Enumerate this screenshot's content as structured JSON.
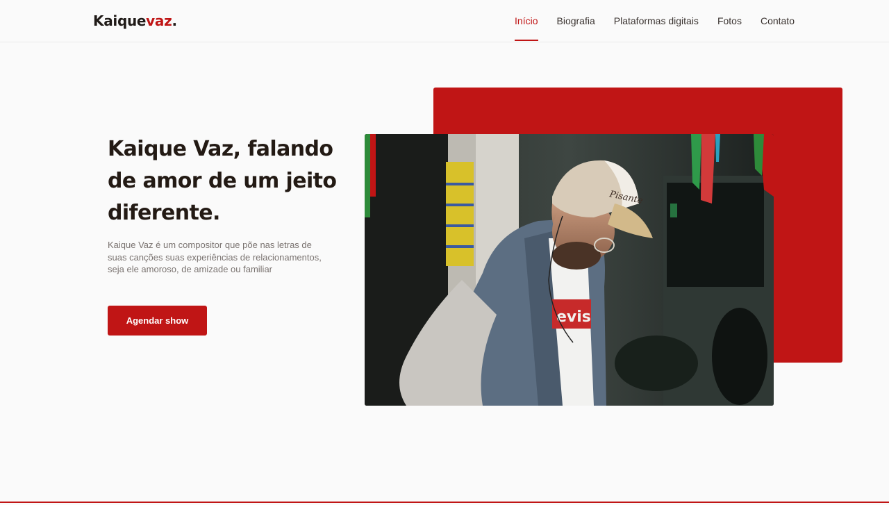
{
  "header": {
    "logo": {
      "main": "Kaique",
      "accent": "vaz",
      "dot": "."
    },
    "nav": [
      {
        "label": "Início",
        "active": true
      },
      {
        "label": "Biografia",
        "active": false
      },
      {
        "label": "Plataformas digitais",
        "active": false
      },
      {
        "label": "Fotos",
        "active": false
      },
      {
        "label": "Contato",
        "active": false
      }
    ]
  },
  "hero": {
    "title": "Kaique Vaz, falando de amor de um jeito diferente.",
    "description": "Kaique Vaz é um compositor que põe nas letras de suas canções suas experiências de relacionamentos, seja ele amoroso, de amizade ou familiar",
    "cta_label": "Agendar show",
    "photo": {
      "cap_text": "Pisante",
      "shirt_text": "evis"
    }
  },
  "colors": {
    "accent": "#c01515",
    "background": "#fafafa",
    "text_dark": "#231a14",
    "text_muted": "#7a7370"
  }
}
